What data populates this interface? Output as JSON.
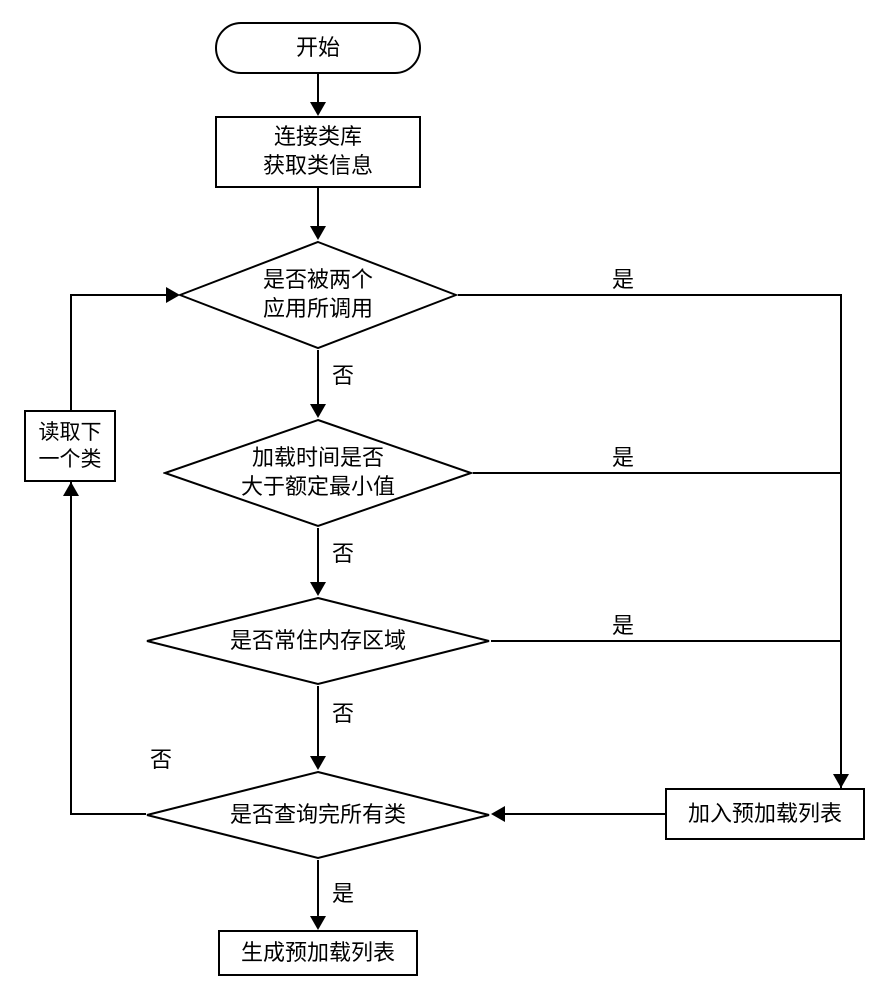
{
  "chart_data": {
    "type": "flowchart",
    "nodes": [
      {
        "id": "start",
        "type": "terminator",
        "label": "开始"
      },
      {
        "id": "connect",
        "type": "process",
        "label": "连接类库\n获取类信息"
      },
      {
        "id": "d1",
        "type": "decision",
        "label": "是否被两个\n应用所调用"
      },
      {
        "id": "d2",
        "type": "decision",
        "label": "加载时间是否\n大于额定最小值"
      },
      {
        "id": "d3",
        "type": "decision",
        "label": "是否常住内存区域"
      },
      {
        "id": "d4",
        "type": "decision",
        "label": "是否查询完所有类"
      },
      {
        "id": "readnext",
        "type": "process",
        "label": "读取下\n一个类"
      },
      {
        "id": "addlist",
        "type": "process",
        "label": "加入预加载列表"
      },
      {
        "id": "genlist",
        "type": "process",
        "label": "生成预加载列表"
      }
    ],
    "edges": [
      {
        "from": "start",
        "to": "connect"
      },
      {
        "from": "connect",
        "to": "d1"
      },
      {
        "from": "d1",
        "to": "addlist",
        "label": "是"
      },
      {
        "from": "d1",
        "to": "d2",
        "label": "否"
      },
      {
        "from": "d2",
        "to": "addlist",
        "label": "是"
      },
      {
        "from": "d2",
        "to": "d3",
        "label": "否"
      },
      {
        "from": "d3",
        "to": "addlist",
        "label": "是"
      },
      {
        "from": "d3",
        "to": "d4",
        "label": "否"
      },
      {
        "from": "addlist",
        "to": "d4"
      },
      {
        "from": "d4",
        "to": "readnext",
        "label": "否"
      },
      {
        "from": "readnext",
        "to": "d1"
      },
      {
        "from": "d4",
        "to": "genlist",
        "label": "是"
      }
    ]
  },
  "nodes": {
    "start": "开始",
    "connect_l1": "连接类库",
    "connect_l2": "获取类信息",
    "d1_l1": "是否被两个",
    "d1_l2": "应用所调用",
    "d2_l1": "加载时间是否",
    "d2_l2": "大于额定最小值",
    "d3": "是否常住内存区域",
    "d4": "是否查询完所有类",
    "readnext_l1": "读取下",
    "readnext_l2": "一个类",
    "addlist": "加入预加载列表",
    "genlist": "生成预加载列表"
  },
  "labels": {
    "yes": "是",
    "no": "否"
  }
}
